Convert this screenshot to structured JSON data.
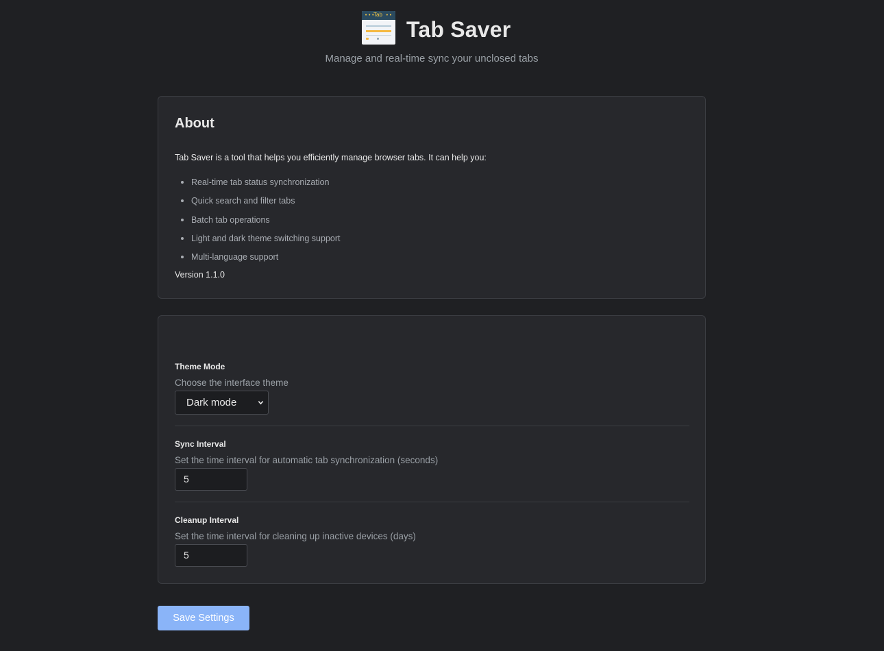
{
  "header": {
    "logo_tab_text": "Tab",
    "title": "Tab Saver",
    "subtitle": "Manage and real-time sync your unclosed tabs"
  },
  "about": {
    "heading": "About",
    "intro": "Tab Saver is a tool that helps you efficiently manage browser tabs. It can help you:",
    "features": [
      "Real-time tab status synchronization",
      "Quick search and filter tabs",
      "Batch tab operations",
      "Light and dark theme switching support",
      "Multi-language support"
    ],
    "version": "Version 1.1.0"
  },
  "settings": {
    "theme": {
      "label": "Theme Mode",
      "description": "Choose the interface theme",
      "selected": "Dark mode"
    },
    "sync": {
      "label": "Sync Interval",
      "description": "Set the time interval for automatic tab synchronization (seconds)",
      "value": "5"
    },
    "cleanup": {
      "label": "Cleanup Interval",
      "description": "Set the time interval for cleaning up inactive devices (days)",
      "value": "5"
    }
  },
  "save_button": "Save Settings",
  "icons": {
    "logo": "app-logo-icon",
    "select_chevron": "chevron-down-icon"
  },
  "colors": {
    "background": "#1f2023",
    "card": "#27282c",
    "accent": "#8ab4f8"
  }
}
